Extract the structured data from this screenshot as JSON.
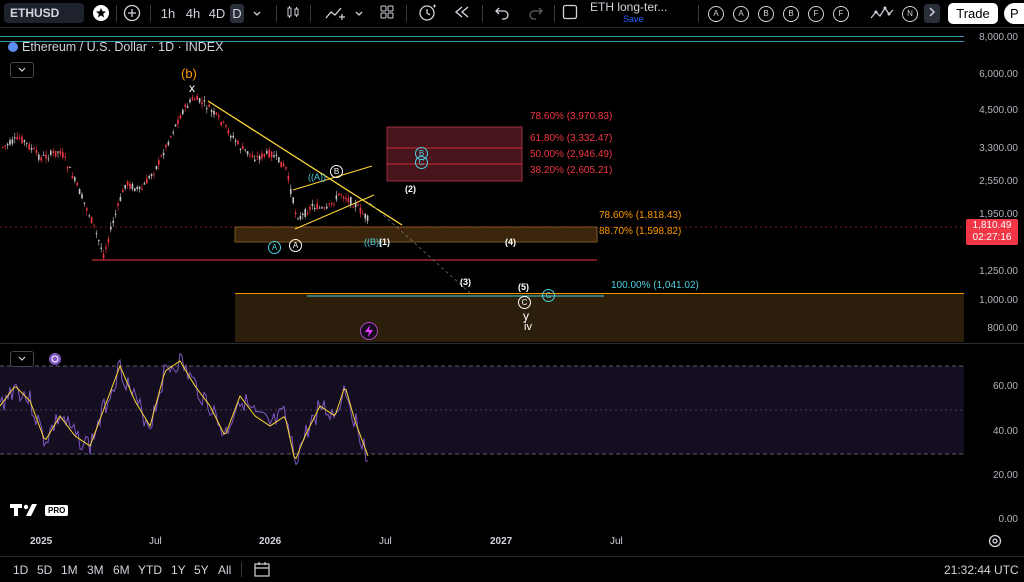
{
  "toolbar": {
    "symbol": "ETHUSD",
    "intervals": [
      "1h",
      "4h",
      "4D",
      "D"
    ],
    "active_interval": "D",
    "layout_name": "ETH long-ter...",
    "layout_sub": "Save",
    "alert_buttons": [
      "A",
      "A",
      "B",
      "B",
      "F",
      "F",
      "N"
    ],
    "trade_label": "Trade",
    "publish_label": "P",
    "icons": [
      "star-icon",
      "plus-icon",
      "chevron-down-icon",
      "candles-icon",
      "indicators-icon",
      "grid-icon",
      "layout-icon",
      "alert-icon",
      "replay-icon",
      "undo-icon",
      "redo-icon",
      "square-icon",
      "wave-icon",
      "chevron-right-icon"
    ]
  },
  "legend": {
    "title": "Ethereum / U.S. Dollar · 1D · INDEX"
  },
  "price_scale": [
    "8,000.00",
    "6,000.00",
    "4,500.00",
    "3,300.00",
    "2,550.00",
    "1,950.00",
    "1,250.00",
    "1,000.00",
    "800.00"
  ],
  "last_price": "1,810.49",
  "countdown": "02:27:16",
  "rsi_scale": [
    "60.00",
    "40.00",
    "20.00",
    "0.00"
  ],
  "x_ticks": [
    "2025",
    "Jul",
    "2026",
    "Jul",
    "2027",
    "Jul"
  ],
  "fib_labels": [
    {
      "text": "78.60% (3,970.83)",
      "color": "#f23645"
    },
    {
      "text": "61.80% (3,332.47)",
      "color": "#f23645"
    },
    {
      "text": "50.00% (2,946.49)",
      "color": "#f23645"
    },
    {
      "text": "38.20% (2,605.21)",
      "color": "#f23645"
    },
    {
      "text": "78.60% (1,818.43)",
      "color": "#ff9800"
    },
    {
      "text": "88.70% (1,598.82)",
      "color": "#ff9800"
    },
    {
      "text": "100.00% (1,041.02)",
      "color": "#4dd0e1"
    }
  ],
  "waves": {
    "b_orange": "(b)",
    "x_label": "x",
    "A_cyan": "A",
    "A_white": "A",
    "A_paren": "(A)",
    "B_circle": "B",
    "B_paren": "(B)",
    "w1": "(1)",
    "w2": "(2)",
    "w3": "(3)",
    "w4": "(4)",
    "w5": "(5)",
    "C_circle": "C",
    "C_cyan": "C",
    "B_cyan": "B",
    "C_paren_cyan": "C",
    "y_label": "y",
    "iv_label": "iv"
  },
  "bottom": {
    "ranges": [
      "1D",
      "5D",
      "1M",
      "3M",
      "6M",
      "YTD",
      "1Y",
      "5Y",
      "All"
    ],
    "time": "21:32:44 UTC",
    "logo": "TV PRO"
  },
  "colors": {
    "candle_up": "#c8c8c8",
    "candle_down": "#f23645",
    "rsi": "#7e57c2",
    "rsi_ma": "#fdd835",
    "trendline": "#fdd835",
    "fib_box": "#b2283a",
    "support_box": "#3a2a10"
  }
}
